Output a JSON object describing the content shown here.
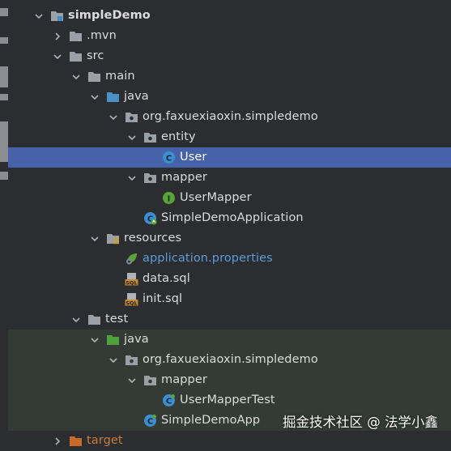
{
  "tree": {
    "project": "simpleDemo",
    "mvn": ".mvn",
    "src": "src",
    "main": "main",
    "main_java": "java",
    "main_package": "org.faxuexiaoxin.simpledemo",
    "entity": "entity",
    "user": "User",
    "mapper": "mapper",
    "user_mapper": "UserMapper",
    "app": "SimpleDemoApplication",
    "resources": "resources",
    "app_props": "application.properties",
    "data_sql": "data.sql",
    "init_sql": "init.sql",
    "test": "test",
    "test_java": "java",
    "test_package": "org.faxuexiaoxin.simpledemo",
    "test_mapper": "mapper",
    "user_mapper_test": "UserMapperTest",
    "app_test": "SimpleDemoApp",
    "target": "target"
  },
  "watermark": "掘金技术社区 @ 法学小鑫",
  "colors": {
    "background": "#2b2d30",
    "selection": "#4662a8",
    "test_area": "#343b35",
    "folder": "#9aa0a6",
    "java_folder": "#4a8fc6",
    "test_folder": "#4fa23b",
    "class_icon": "#3d8ecf",
    "interface_icon": "#5aa33a",
    "link_text": "#5d9bd6"
  },
  "icons": {
    "project": "module-folder-icon",
    "folder": "folder-icon",
    "source_root": "source-root-icon",
    "test_root": "test-root-icon",
    "package": "package-icon",
    "class": "class-icon",
    "interface": "interface-icon",
    "spring_boot": "spring-boot-app-icon",
    "resources": "resources-folder-icon",
    "properties": "spring-properties-icon",
    "sql": "sql-file-icon",
    "target": "excluded-folder-icon"
  }
}
